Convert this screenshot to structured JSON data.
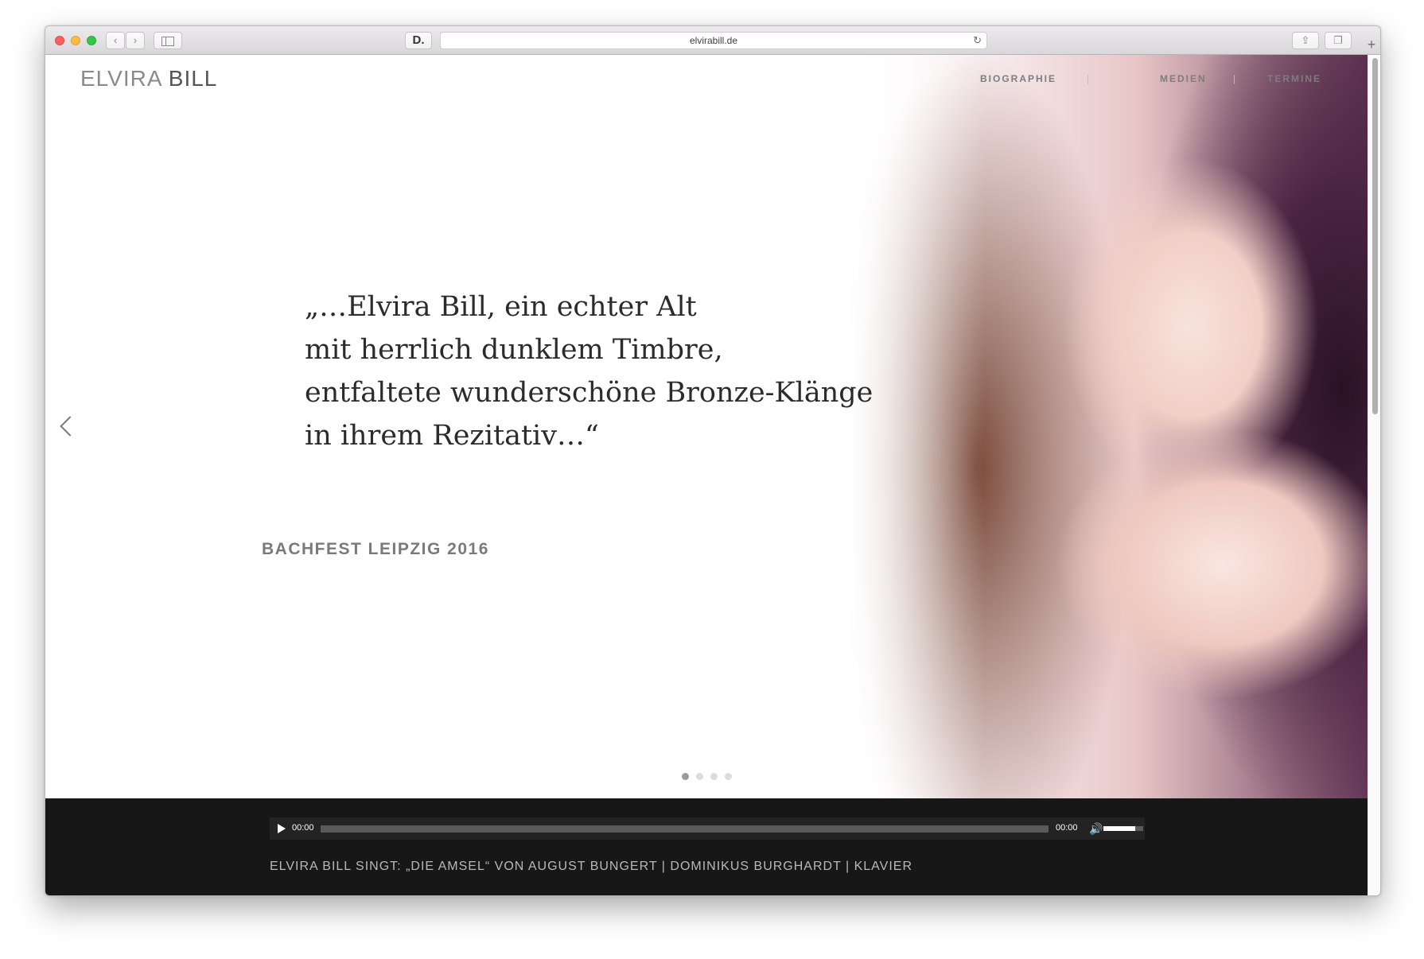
{
  "browser": {
    "url": "elvirabill.de",
    "reader_icon": "D.",
    "reload_icon": "reload-icon",
    "share_icon": "share-icon",
    "tabs_icon": "tabs-icon",
    "new_tab_icon": "plus-icon"
  },
  "site": {
    "logo_light": "ELVIRA",
    "logo_bold": "BILL",
    "nav": [
      "BIOGRAPHIE",
      "MEDIEN",
      "TERMINE"
    ],
    "nav_separator": "|"
  },
  "slider": {
    "quote_lines": [
      "„…Elvira Bill, ein echter Alt",
      "mit herrlich dunklem Timbre,",
      "entfaltete wunderschöne Bronze-Klänge",
      "in ihrem Rezitativ…“"
    ],
    "source": "BACHFEST LEIPZIG 2016",
    "slide_count": 4,
    "active_slide": 1
  },
  "player": {
    "current_time": "00:00",
    "duration": "00:00",
    "progress": 0,
    "volume": 0.8,
    "caption": "ELVIRA BILL SINGT: „DIE AMSEL“ VON AUGUST BUNGERT | DOMINIKUS BURGHARDT | KLAVIER"
  },
  "colors": {
    "footer_bg": "#171717",
    "quote_text": "#2b2b2b",
    "source_text": "#7a7a7a"
  }
}
